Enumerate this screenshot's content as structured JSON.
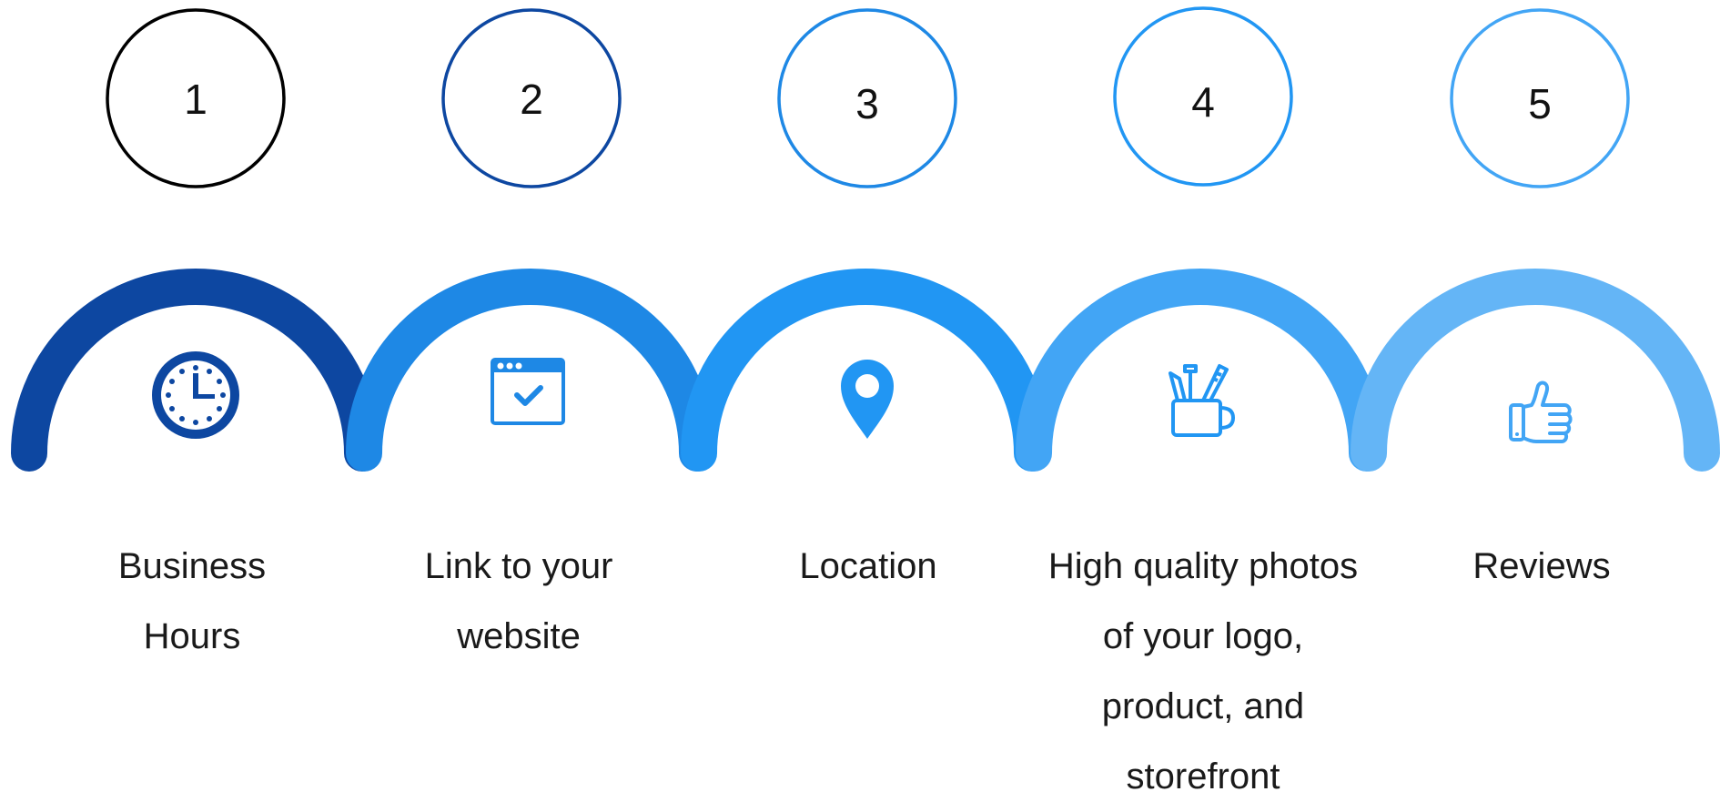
{
  "steps": [
    {
      "number": "1",
      "label_lines": [
        "Business",
        "Hours"
      ],
      "icon": "clock-icon",
      "circle_color": "#000000",
      "arc_color": "#0d47a1"
    },
    {
      "number": "2",
      "label_lines": [
        "Link to your",
        "website"
      ],
      "icon": "browser-check-icon",
      "circle_color": "#0d47a1",
      "arc_color": "#1e88e5"
    },
    {
      "number": "3",
      "label_lines": [
        "Location"
      ],
      "icon": "map-pin-icon",
      "circle_color": "#1e88e5",
      "arc_color": "#2196f3"
    },
    {
      "number": "4",
      "label_lines": [
        "High quality photos",
        "of your logo,",
        "product, and",
        "storefront"
      ],
      "icon": "design-tools-cup-icon",
      "circle_color": "#2196f3",
      "arc_color": "#42a5f5"
    },
    {
      "number": "5",
      "label_lines": [
        "Reviews"
      ],
      "icon": "thumbs-up-icon",
      "circle_color": "#42a5f5",
      "arc_color": "#64b5f6"
    }
  ]
}
